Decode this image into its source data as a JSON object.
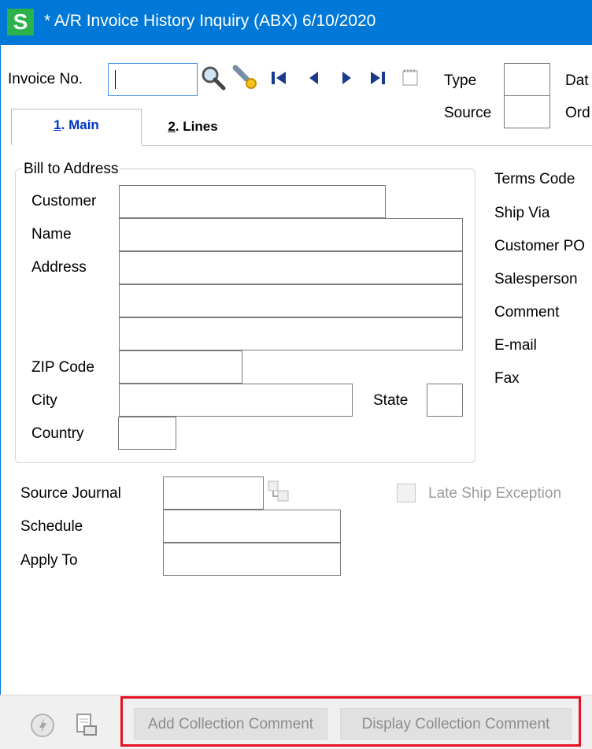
{
  "window": {
    "title": "* A/R Invoice History Inquiry (ABX) 6/10/2020",
    "logo_letter": "S"
  },
  "header": {
    "invoice_label": "Invoice No.",
    "invoice_value": "",
    "type_label": "Type",
    "type_value": "",
    "date_label": "Dat",
    "source_label": "Source",
    "source_value": "",
    "order_label": "Ord"
  },
  "tabs": [
    {
      "hotkey": "1",
      "rest": ". Main",
      "active": true
    },
    {
      "hotkey": "2",
      "rest": ". Lines",
      "active": false
    }
  ],
  "bill_to": {
    "group_title": "Bill to Address",
    "customer_label": "Customer",
    "customer_value": "",
    "name_label": "Name",
    "name_value": "",
    "address_label": "Address",
    "address_lines": [
      "",
      "",
      ""
    ],
    "zip_label": "ZIP Code",
    "zip_value": "",
    "city_label": "City",
    "city_value": "",
    "state_label": "State",
    "state_value": "",
    "country_label": "Country",
    "country_value": ""
  },
  "right_labels": {
    "terms_code": "Terms Code",
    "ship_via": "Ship Via",
    "customer_po": "Customer PO",
    "salesperson": "Salesperson",
    "comment": "Comment",
    "email": "E-mail",
    "fax": "Fax"
  },
  "lower": {
    "source_journal_label": "Source Journal",
    "source_journal_value": "",
    "schedule_label": "Schedule",
    "schedule_value": "",
    "apply_to_label": "Apply To",
    "apply_to_value": "",
    "late_ship_label": "Late Ship Exception",
    "late_ship_checked": false
  },
  "footer": {
    "add_comment_label": "Add Collection Comment",
    "display_comment_label": "Display Collection Comment"
  },
  "colors": {
    "titlebar": "#0078d7",
    "logo": "#2bb24c",
    "highlight": "#e81123",
    "active_tab_text": "#0033cc"
  }
}
